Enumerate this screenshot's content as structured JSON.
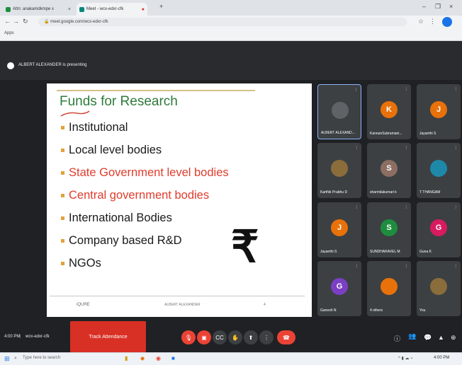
{
  "browser": {
    "tabs": [
      {
        "label": "Attn: anakamdkmpe x",
        "active": false
      },
      {
        "label": "Meet - wcx-edxr-cfk",
        "active": true
      }
    ],
    "new_tab": "+",
    "url": "meet.google.com/wcx-edxr-cfk",
    "bookmark_label": "Apps"
  },
  "meet": {
    "presenting_label": "ALBERT ALEXANDER is presenting",
    "slide": {
      "title": "Funds for Research",
      "bullets": [
        {
          "text": "Institutional",
          "color": "#1a1a1a"
        },
        {
          "text": "Local level bodies",
          "color": "#1a1a1a"
        },
        {
          "text": "State Government level bodies",
          "color": "#e03c2c"
        },
        {
          "text": "Central government bodies",
          "color": "#e03c2c"
        },
        {
          "text": "International Bodies",
          "color": "#1a1a1a"
        },
        {
          "text": "Company based R&D",
          "color": "#1a1a1a"
        },
        {
          "text": "NGOs",
          "color": "#1a1a1a"
        }
      ],
      "rupee_symbol": "₹",
      "footer_left": "iQURE",
      "footer_mid": "ALBERT ALEXANDER",
      "footer_page": "4"
    },
    "participants": [
      {
        "name": "ALBERT ALEXAND...",
        "initial": "",
        "color": "#5f6368"
      },
      {
        "name": "KannanSubramani...",
        "initial": "K",
        "color": "#e8710a"
      },
      {
        "name": "Jayanthi S",
        "initial": "J",
        "color": "#e8710a"
      },
      {
        "name": "Karthik Prabhu D",
        "initial": "",
        "color": "#8a6d3b"
      },
      {
        "name": "sharmilakumari k",
        "initial": "S",
        "color": "#8d6e63"
      },
      {
        "name": "T THANGAM",
        "initial": "",
        "color": "#1e88a8"
      },
      {
        "name": "Jayanthi S",
        "initial": "J",
        "color": "#e8710a"
      },
      {
        "name": "SUNDHARAVEL M",
        "initial": "S",
        "color": "#1e8e3e"
      },
      {
        "name": "Guna K",
        "initial": "G",
        "color": "#d81b60"
      },
      {
        "name": "Ganesh N",
        "initial": "G",
        "color": "#7b3fc4"
      },
      {
        "name": "4 others",
        "initial": "",
        "color": "#e8710a"
      },
      {
        "name": "You",
        "initial": "",
        "color": "#8a6d3b"
      }
    ],
    "time": "4:00 PM",
    "meeting_code": "wcx-edxr-cfk",
    "track_attendance": "Track Attendance",
    "accent_red": "#ea4335"
  },
  "taskbar": {
    "search_placeholder": "Type here to search",
    "clock": "4:00 PM"
  }
}
